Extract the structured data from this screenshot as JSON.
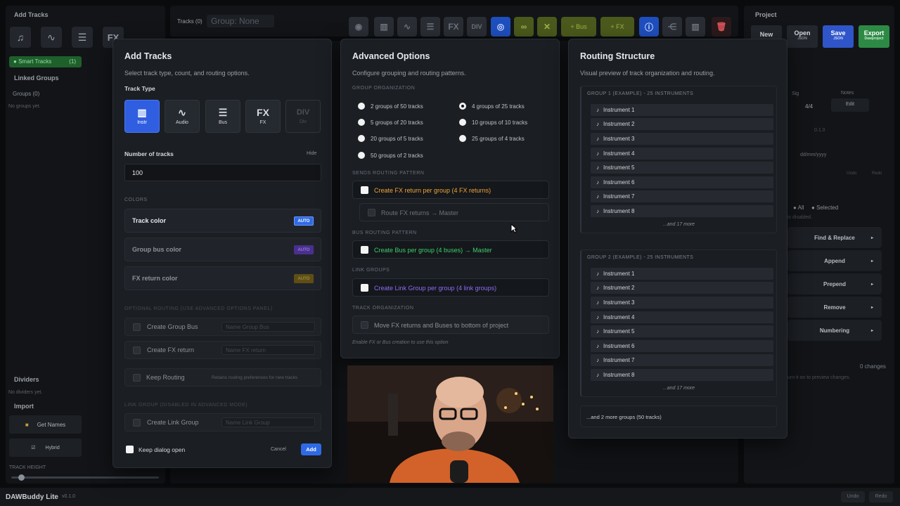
{
  "left_panel": {
    "title": "Add Tracks",
    "smart_tracks": "Smart Tracks",
    "smart_count": "(1)",
    "linked_groups": "Linked Groups",
    "groups_count": "Groups (0)",
    "no_groups": "No groups yet.",
    "dividers": "Dividers",
    "no_dividers": "No dividers yet.",
    "import": "Import",
    "get_names": "Get Names",
    "hybrid": "Hybrid",
    "track_height": "TRACK HEIGHT",
    "track_height_value": "0.6"
  },
  "toolbar": {
    "tracks_label": "Tracks (0)",
    "group_label": "Group: None",
    "bus": "+ Bus",
    "fx": "+ FX"
  },
  "right_panel": {
    "title": "Project",
    "new": "New",
    "open": "Open",
    "open_sub": "JSON",
    "save": "Save",
    "save_sub": "JSON",
    "export": "Export",
    "export_sub": "Dawproject",
    "sig_label": "Sig",
    "sig_value": "4/4",
    "notes_label": "Notes",
    "edit": "Edit",
    "version": "0.1.0",
    "date_placeholder": "dd/mm/yyyy",
    "undo": "Undo",
    "redo": "Redo",
    "all": "All",
    "selected": "Selected",
    "disabled_note": "is disabled.",
    "find_replace": "Find & Replace",
    "append": "Append",
    "prepend": "Prepend",
    "remove": "Remove",
    "numbering": "Numbering",
    "changes": "0 changes",
    "preview_hint": "urn it on to preview changes."
  },
  "footer": {
    "app_name": "DAWBuddy Lite",
    "version": "v0.1.0",
    "undo": "Undo",
    "redo": "Redo"
  },
  "add_tracks": {
    "title": "Add Tracks",
    "subtitle": "Select track type, count, and routing options.",
    "track_type_label": "Track Type",
    "types": [
      {
        "label": "Instr",
        "icon": "piano-icon"
      },
      {
        "label": "Audio",
        "icon": "waveform-icon"
      },
      {
        "label": "Bus",
        "icon": "mixer-icon"
      },
      {
        "label": "FX",
        "icon": "fx-icon"
      },
      {
        "label": "Div",
        "icon": "divider-icon"
      }
    ],
    "num_tracks_label": "Number of tracks",
    "hide": "Hide",
    "num_tracks_value": "100",
    "colors_label": "COLORS",
    "track_color": "Track color",
    "group_bus_color": "Group bus color",
    "fx_return_color": "FX return color",
    "auto": "AUTO",
    "optional_routing": "OPTIONAL ROUTING (USE ADVANCED OPTIONS PANEL)",
    "create_group_bus": "Create Group Bus",
    "group_bus_placeholder": "Name Group Bus",
    "create_fx_return": "Create FX return",
    "fx_return_placeholder": "Name FX return",
    "keep_routing": "Keep Routing",
    "keep_routing_hint": "Retains routing preferences for new tracks",
    "link_group_label": "LINK GROUP (DISABLED IN ADVANCED MODE)",
    "create_link_group": "Create Link Group",
    "link_group_placeholder": "Name Link Group",
    "keep_dialog_open": "Keep dialog open",
    "cancel": "Cancel",
    "add": "Add",
    "colors": {
      "auto": "#2f6ae6",
      "purple": "#5a3aa8",
      "gold": "#6e5a1a"
    }
  },
  "advanced": {
    "title": "Advanced Options",
    "subtitle": "Configure grouping and routing patterns.",
    "group_org_label": "GROUP ORGANIZATION",
    "options_left": [
      "2 groups of 50 tracks",
      "5 groups of 20 tracks",
      "20 groups of 5 tracks",
      "50 groups of 2 tracks"
    ],
    "options_right": [
      "4 groups of 25 tracks",
      "10 groups of 10 tracks",
      "25 groups of 4 tracks"
    ],
    "sends_label": "SENDS ROUTING PATTERN",
    "create_fx_return": "Create FX return per group (4 FX returns)",
    "route_fx": "Route FX returns → Master",
    "bus_label": "BUS ROUTING PATTERN",
    "create_bus": "Create Bus per group (4 buses) → Master",
    "link_label": "LINK GROUPS",
    "create_link": "Create Link Group per group (4 link groups)",
    "track_org_label": "TRACK ORGANIZATION",
    "move_fx": "Move FX returns and Buses to bottom of project",
    "footnote": "Enable FX or Bus creation to use this option",
    "colors": {
      "fx": "#f0a43a",
      "bus": "#3ecf6a",
      "link": "#8f6cf5"
    }
  },
  "routing": {
    "title": "Routing Structure",
    "subtitle": "Visual preview of track organization and routing.",
    "group1_header": "GROUP 1 (EXAMPLE) - 25 INSTRUMENTS",
    "group2_header": "GROUP 2 (EXAMPLE) - 25 INSTRUMENTS",
    "instruments": [
      "Instrument 1",
      "Instrument 2",
      "Instrument 3",
      "Instrument 4",
      "Instrument 5",
      "Instrument 6",
      "Instrument 7",
      "Instrument 8"
    ],
    "more": "...and 17 more",
    "more_groups": "...and 2 more groups (50 tracks)"
  }
}
